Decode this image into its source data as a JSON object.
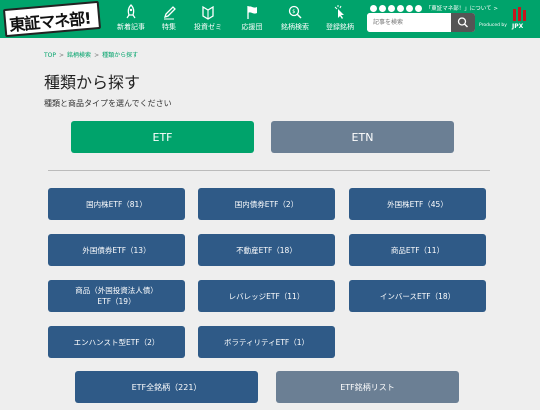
{
  "header": {
    "logo": "東証マネ部!",
    "nav": [
      {
        "label": "新着記事",
        "icon": "rocket-icon"
      },
      {
        "label": "特集",
        "icon": "pen-icon"
      },
      {
        "label": "投資ゼミ",
        "icon": "hat-icon"
      },
      {
        "label": "応援団",
        "icon": "flag-icon"
      },
      {
        "label": "銘柄検索",
        "icon": "magnifier-coin-icon"
      },
      {
        "label": "登録銘柄",
        "icon": "pointer-click-icon"
      }
    ],
    "social_text": "「東証マネ部！」について >",
    "search_placeholder": "記事を検索",
    "produced_by": "Produced by",
    "jpx": "JPX"
  },
  "breadcrumb": [
    "TOP",
    "銘柄検索",
    "種類から探す"
  ],
  "page_title": "種類から探す",
  "subtitle": "種類と商品タイプを選んでください",
  "toggles": {
    "etf": "ETF",
    "etn": "ETN"
  },
  "categories": [
    "国内株ETF（81）",
    "国内債券ETF（2）",
    "外国株ETF（45）",
    "外国債券ETF（13）",
    "不動産ETF（18）",
    "商品ETF（11）",
    "商品（外国投資法人債）\nETF（19）",
    "レバレッジETF（11）",
    "インバースETF（18）",
    "エンハンスト型ETF（2）",
    "ボラティリティETF（1）"
  ],
  "bottom": {
    "all": "ETF全銘柄（221）",
    "list": "ETF銘柄リスト"
  },
  "colors": {
    "brand_green": "#00a36b",
    "category_blue": "#2f5a87",
    "inactive_gray": "#6b7f94"
  }
}
